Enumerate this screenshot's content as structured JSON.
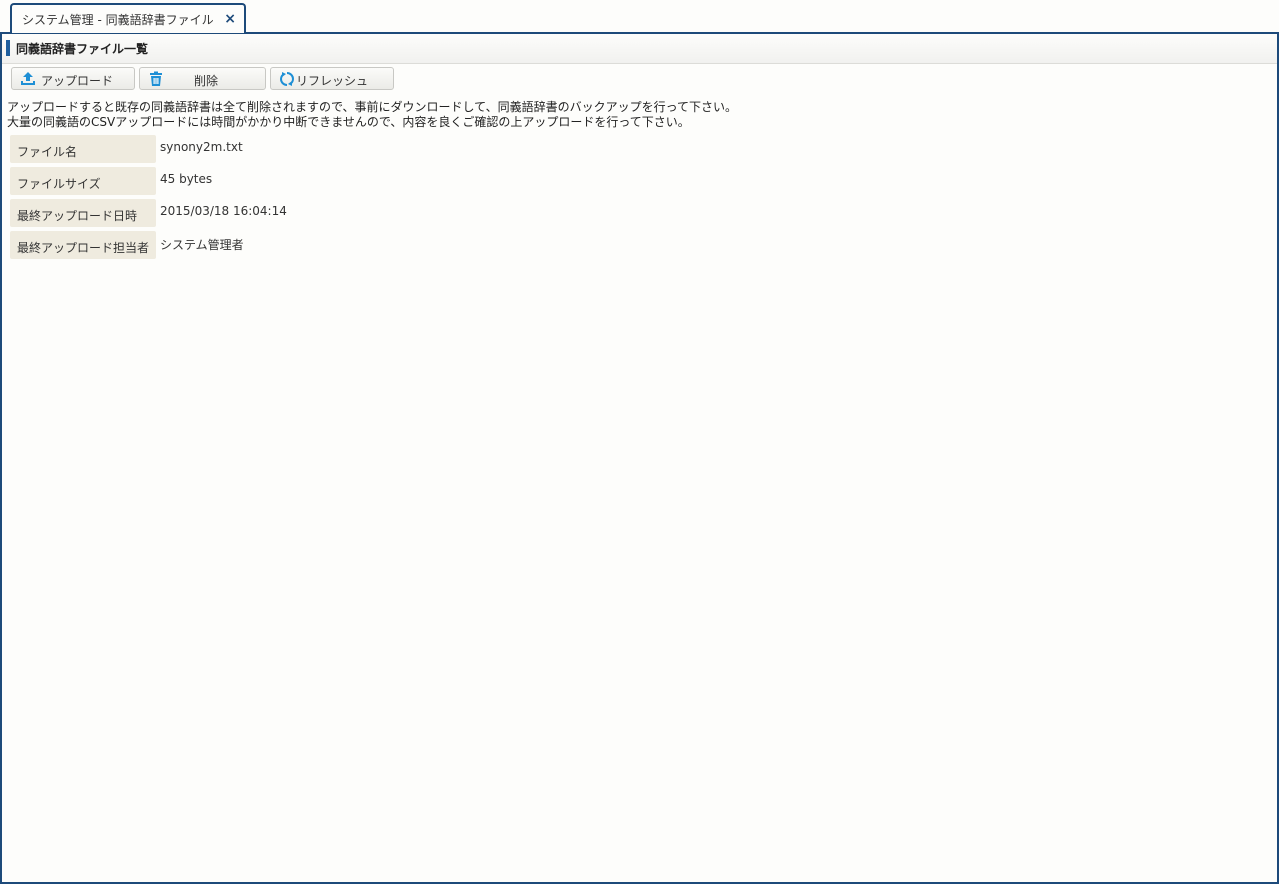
{
  "tab": {
    "title": "システム管理 - 同義語辞書ファイル",
    "close": "×"
  },
  "panel": {
    "title": "同義語辞書ファイル一覧"
  },
  "toolbar": {
    "upload_label": "アップロード",
    "delete_label": "削除",
    "refresh_label": "リフレッシュ"
  },
  "notes": {
    "line1": "アップロードすると既存の同義語辞書は全て削除されますので、事前にダウンロードして、同義語辞書のバックアップを行って下さい。",
    "line2": "大量の同義語のCSVアップロードには時間がかかり中断できませんので、内容を良くご確認の上アップロードを行って下さい。"
  },
  "info": [
    {
      "label": "ファイル名",
      "value": "synony2m.txt"
    },
    {
      "label": "ファイルサイズ",
      "value": "45 bytes"
    },
    {
      "label": "最終アップロード日時",
      "value": "2015/03/18 16:04:14"
    },
    {
      "label": "最終アップロード担当者",
      "value": "システム管理者"
    }
  ],
  "colors": {
    "accent": "#1d4a7a",
    "icon": "#1e8fd5",
    "label_bg": "#efebdf"
  }
}
